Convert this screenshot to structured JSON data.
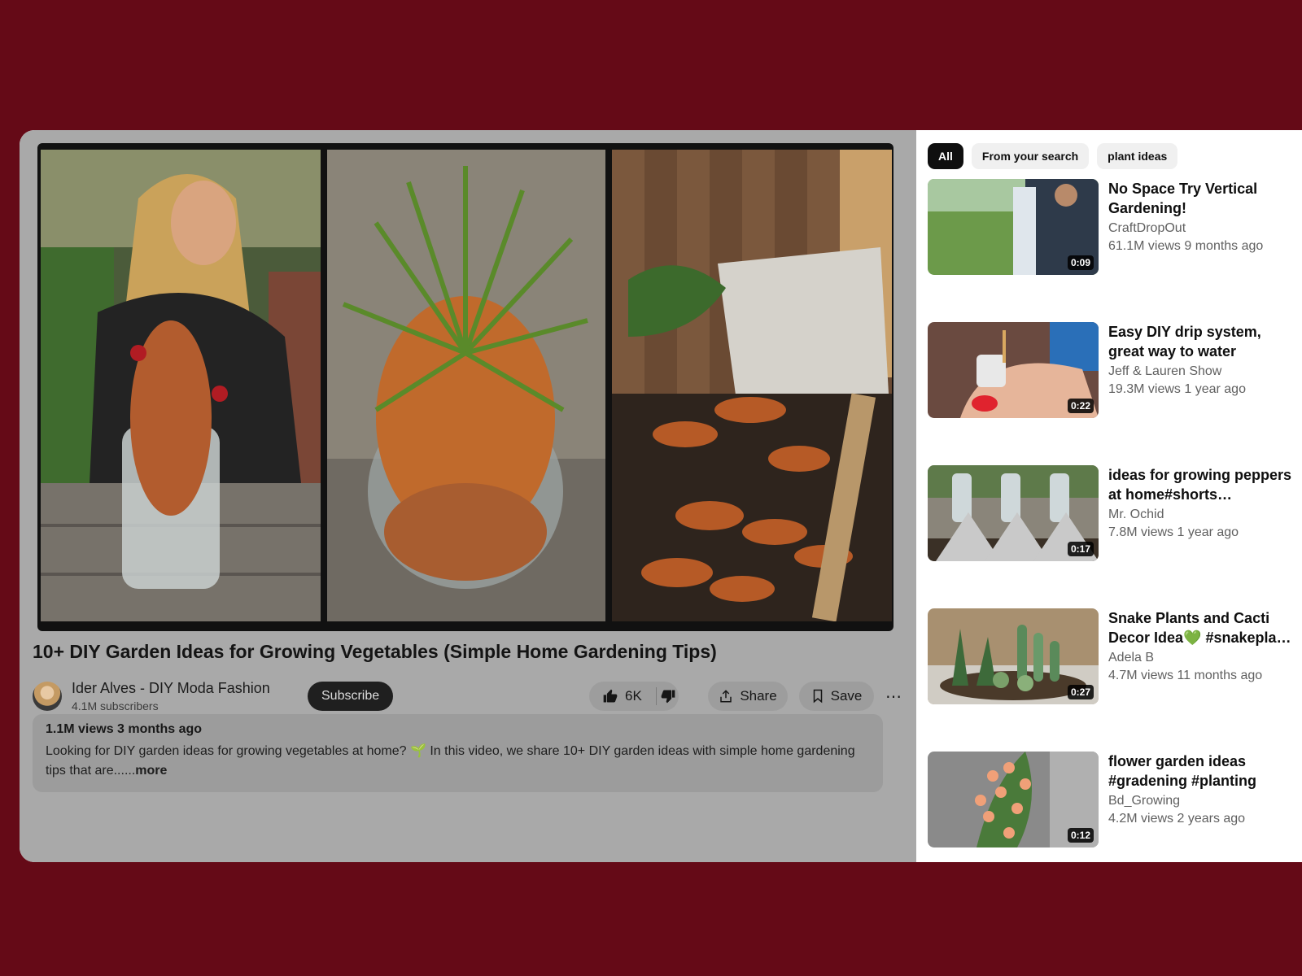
{
  "video": {
    "title": "10+ DIY Garden Ideas for Growing Vegetables (Simple Home Gardening Tips)",
    "channel": "Ider Alves - DIY Moda Fashion",
    "subscribers": "4.1M subscribers",
    "subscribe_label": "Subscribe",
    "likes": "6K",
    "share_label": "Share",
    "save_label": "Save",
    "more_icon": "⋯",
    "description": {
      "meta": "1.1M views 3 months ago",
      "text": "Looking for DIY garden ideas for growing vegetables at home? 🌱 In this video, we share 10+ DIY garden ideas with simple home gardening tips that are......",
      "more": "more"
    }
  },
  "chips": [
    "All",
    "From your search",
    "plant ideas"
  ],
  "recommendations": [
    {
      "title": "No Space Try Vertical Gardening!",
      "channel": "CraftDropOut",
      "meta": "61.1M views 9 months ago",
      "duration": "0:09"
    },
    {
      "title": "Easy DIY drip system, great way to water plants…",
      "channel": "Jeff & Lauren Show",
      "meta": "19.3M views 1 year ago",
      "duration": "0:22"
    },
    {
      "title": "ideas for growing peppers at home#shorts…",
      "channel": "Mr. Ochid",
      "meta": "7.8M views 1 year ago",
      "duration": "0:17"
    },
    {
      "title": "Snake Plants and Cacti Decor Idea💚 #snakepla…",
      "channel": "Adela B",
      "meta": "4.7M views 11 months ago",
      "duration": "0:27"
    },
    {
      "title": "flower garden ideas #gradening #planting",
      "channel": "Bd_Growing",
      "meta": "4.2M views 2 years ago",
      "duration": "0:12"
    }
  ]
}
